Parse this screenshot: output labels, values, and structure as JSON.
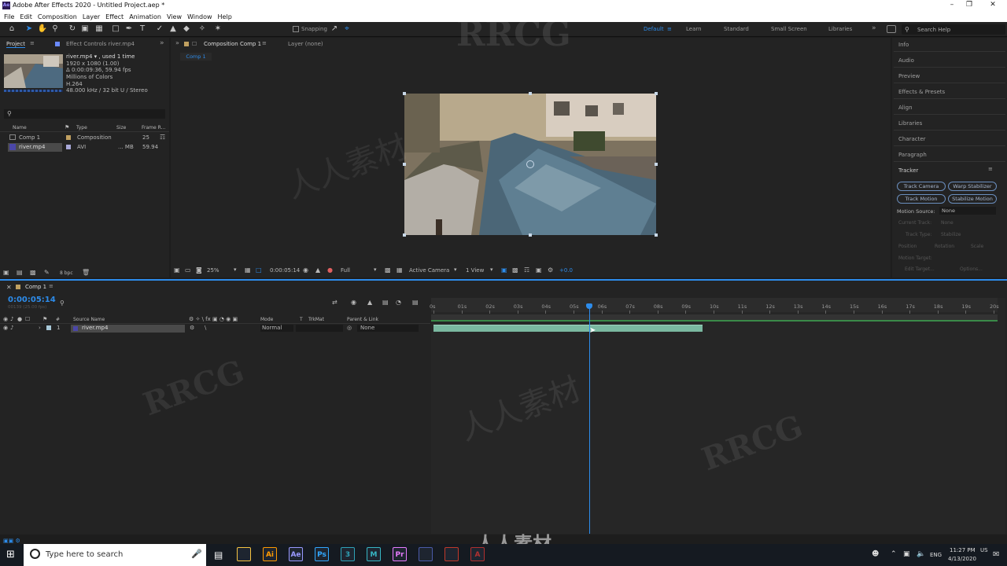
{
  "app": {
    "title": "Adobe After Effects 2020 - Untitled Project.aep *",
    "logo": "Ae"
  },
  "menu": [
    "File",
    "Edit",
    "Composition",
    "Layer",
    "Effect",
    "Animation",
    "View",
    "Window",
    "Help"
  ],
  "toolbar": {
    "snapping_label": "Snapping",
    "workspaces": [
      "Default",
      "Learn",
      "Standard",
      "Small Screen",
      "Libraries"
    ],
    "active_workspace": "Default",
    "search_placeholder": "Search Help"
  },
  "project_panel": {
    "tab": "Project",
    "effect_controls_tab": "Effect Controls river.mp4",
    "item_name": "river.mp4 ▾ , used 1 time",
    "item_info": [
      "1920 x 1080 (1.00)",
      "Δ 0:00:09:36, 59.94 fps",
      "Millions of Colors",
      "H.264",
      "48.000 kHz / 32 bit U / Stereo"
    ],
    "columns": [
      "Name",
      "Type",
      "Size",
      "Frame R..."
    ],
    "rows": [
      {
        "name": "Comp 1",
        "type": "Composition",
        "size": "",
        "fps": "25"
      },
      {
        "name": "river.mp4",
        "type": "AVI",
        "size": "... MB",
        "fps": "59.94"
      }
    ],
    "bpc": "8 bpc"
  },
  "comp_panel": {
    "tab": "Composition Comp 1",
    "layer_tab": "Layer (none)",
    "comp_chip": "Comp 1",
    "zoom": "25%",
    "timecode": "0:00:05:14",
    "resolution": "Full",
    "camera": "Active Camera",
    "views": "1 View",
    "exposure": "+0.0"
  },
  "right_panel": {
    "items": [
      "Info",
      "Audio",
      "Preview",
      "Effects & Presets",
      "Align",
      "Libraries",
      "Character",
      "Paragraph"
    ],
    "tracker": {
      "title": "Tracker",
      "buttons": [
        "Track Camera",
        "Warp Stabilizer",
        "Track Motion",
        "Stabilize Motion"
      ],
      "motion_source_label": "Motion Source:",
      "motion_source_value": "None",
      "current_track_label": "Current Track:",
      "current_track_value": "None",
      "track_type_label": "Track Type:",
      "track_type_value": "Stabilize",
      "checks": [
        "Position",
        "Rotation",
        "Scale"
      ],
      "motion_target": "Motion Target:",
      "edit_target": "Edit Target...",
      "options": "Options..."
    }
  },
  "timeline": {
    "tab": "Comp 1",
    "timecode": "0:00:05:14",
    "frames": "00139 (25.00 fps)",
    "columns": {
      "num": "#",
      "source": "Source Name",
      "mode": "Mode",
      "t": "T",
      "trkmat": "TrkMat",
      "parent": "Parent & Link"
    },
    "layer": {
      "index": "1",
      "name": "river.mp4",
      "mode": "Normal",
      "parent": "None"
    },
    "ruler": [
      "0s",
      "01s",
      "02s",
      "03s",
      "04s",
      "05s",
      "06s",
      "07s",
      "08s",
      "09s",
      "10s",
      "11s",
      "12s",
      "13s",
      "14s",
      "15s",
      "16s",
      "17s",
      "18s",
      "19s",
      "20s"
    ],
    "duration_s": 20,
    "playhead_s": 5.56,
    "clip_start_s": 0,
    "clip_end_s": 9.6
  },
  "taskbar": {
    "search_placeholder": "Type here to search",
    "apps": [
      {
        "icon": "file-explorer-icon",
        "label": "",
        "color": "#f5c342"
      },
      {
        "icon": "illustrator-icon",
        "label": "Ai",
        "color": "#ff9a00"
      },
      {
        "icon": "after-effects-icon",
        "label": "Ae",
        "color": "#9999ff"
      },
      {
        "icon": "photoshop-icon",
        "label": "Ps",
        "color": "#31a8ff"
      },
      {
        "icon": "3ds-icon",
        "label": "3",
        "color": "#2fa3b8"
      },
      {
        "icon": "maya-icon",
        "label": "M",
        "color": "#37b6c4"
      },
      {
        "icon": "premiere-icon",
        "label": "Pr",
        "color": "#e77bff"
      },
      {
        "icon": "chrome-icon",
        "label": "",
        "color": "#4a5aa8"
      },
      {
        "icon": "media-icon",
        "label": "",
        "color": "#c0392b"
      },
      {
        "icon": "app-red-icon",
        "label": "A",
        "color": "#b03030"
      }
    ],
    "lang": "ENG",
    "time": "11:27 PM",
    "date": "4/13/2020",
    "us": "US"
  },
  "watermarks": [
    "RRCG",
    "人人素材"
  ]
}
